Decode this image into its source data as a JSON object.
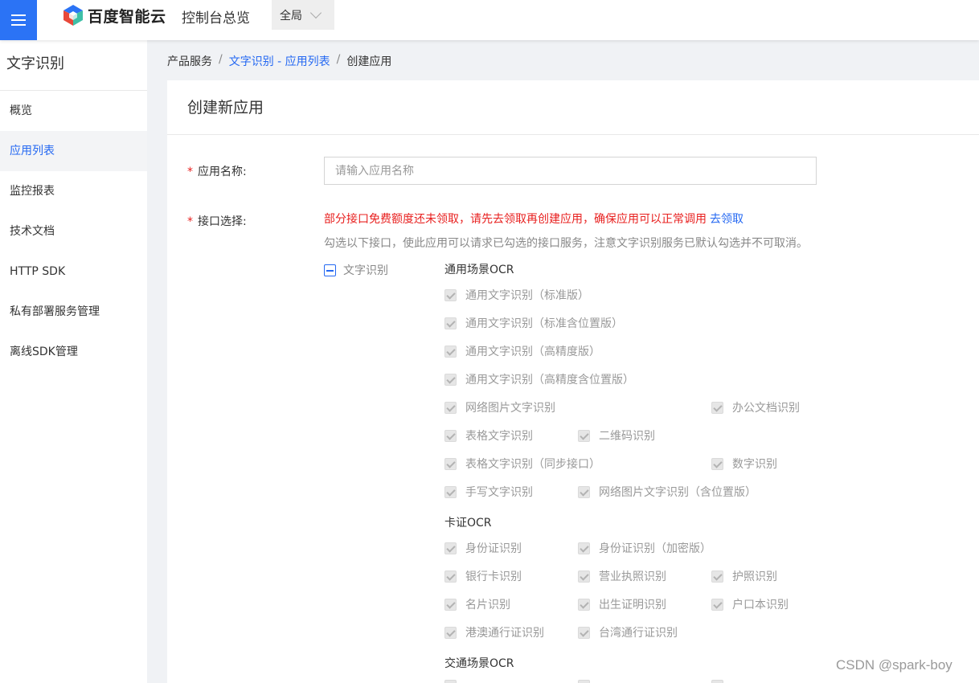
{
  "header": {
    "brand": "百度智能云",
    "console": "控制台总览",
    "region": "全局"
  },
  "sidebar": {
    "title": "文字识别",
    "items": [
      {
        "label": "概览",
        "active": false
      },
      {
        "label": "应用列表",
        "active": true
      },
      {
        "label": "监控报表",
        "active": false
      },
      {
        "label": "技术文档",
        "active": false
      },
      {
        "label": "HTTP SDK",
        "active": false
      },
      {
        "label": "私有部署服务管理",
        "active": false
      },
      {
        "label": "离线SDK管理",
        "active": false
      }
    ]
  },
  "breadcrumb": {
    "root": "产品服务",
    "sep": "/",
    "link": "文字识别 - 应用列表",
    "current": "创建应用"
  },
  "panel": {
    "title": "创建新应用"
  },
  "form": {
    "required_mark": "*",
    "name_label": "应用名称:",
    "name_placeholder": "请输入应用名称",
    "name_value": "",
    "api_label": "接口选择:",
    "warning": "部分接口免费额度还未领取，请先去领取再创建应用，确保应用可以正常调用",
    "warning_link": "去领取",
    "hint": "勾选以下接口，使此应用可以请求已勾选的接口服务，注意文字识别服务已默认勾选并不可取消。",
    "parent_service": "文字识别",
    "groups": [
      {
        "title": "通用场景OCR"
      },
      {
        "title": "卡证OCR"
      },
      {
        "title": "交通场景OCR"
      }
    ],
    "options": {
      "o1": "通用文字识别（标准版）",
      "o2": "通用文字识别（标准含位置版）",
      "o3": "通用文字识别（高精度版）",
      "o4": "通用文字识别（高精度含位置版）",
      "o5": "网络图片文字识别",
      "o6": "办公文档识别",
      "o7": "表格文字识别",
      "o8": "二维码识别",
      "o9": "表格文字识别（同步接口）",
      "o10": "数字识别",
      "o11": "手写文字识别",
      "o12": "网络图片文字识别（含位置版）",
      "o13": "身份证识别",
      "o14": "身份证识别（加密版）",
      "o15": "银行卡识别",
      "o16": "营业执照识别",
      "o17": "护照识别",
      "o18": "名片识别",
      "o19": "出生证明识别",
      "o20": "户口本识别",
      "o21": "港澳通行证识别",
      "o22": "台湾通行证识别"
    }
  },
  "watermark": "CSDN @spark-boy",
  "colors": {
    "accent": "#2468f2",
    "menu_button": "#2b73f5",
    "warning": "#e8201f"
  }
}
